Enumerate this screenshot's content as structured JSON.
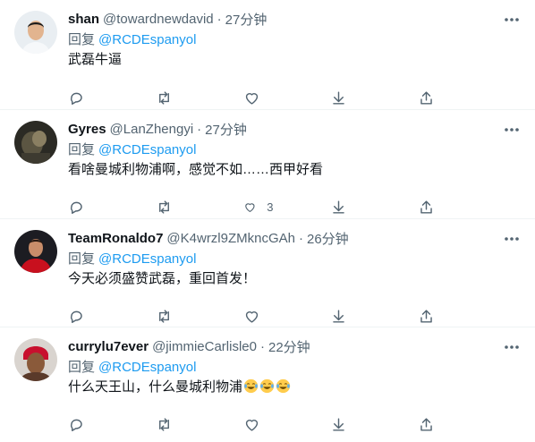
{
  "tweets": [
    {
      "name": "shan",
      "handle": "@towardnewdavid",
      "time": "27分钟",
      "reply_prefix": "回复",
      "reply_mention": "@RCDEspanyol",
      "text": "武磊牛逼",
      "like_count": ""
    },
    {
      "name": "Gyres",
      "handle": "@LanZhengyi",
      "time": "27分钟",
      "reply_prefix": "回复",
      "reply_mention": "@RCDEspanyol",
      "text": "看啥曼城利物浦啊，感觉不如……西甲好看",
      "like_count": "3"
    },
    {
      "name": "TeamRonaldo7",
      "handle": "@K4wrzl9ZMkncGAh",
      "time": "26分钟",
      "reply_prefix": "回复",
      "reply_mention": "@RCDEspanyol",
      "text": "今天必须盛赞武磊，重回首发！",
      "like_count": ""
    },
    {
      "name": "currylu7ever",
      "handle": "@jimmieCarlisle0",
      "time": "22分钟",
      "reply_prefix": "回复",
      "reply_mention": "@RCDEspanyol",
      "text": "什么天王山，什么曼城利物浦",
      "emojis": [
        "face-with-tears-of-joy",
        "face-with-tears-of-joy",
        "face-with-tears-of-joy"
      ],
      "like_count": ""
    }
  ],
  "colors": {
    "link": "#1d9bf0",
    "secondary_text": "#536471",
    "primary_text": "#0f1419",
    "divider": "#eff3f4"
  },
  "icons": {
    "reply": "reply-icon",
    "retweet": "retweet-icon",
    "like": "heart-icon",
    "share_dm": "download-arrow-icon",
    "share": "share-icon",
    "more": "more-dots-icon"
  }
}
